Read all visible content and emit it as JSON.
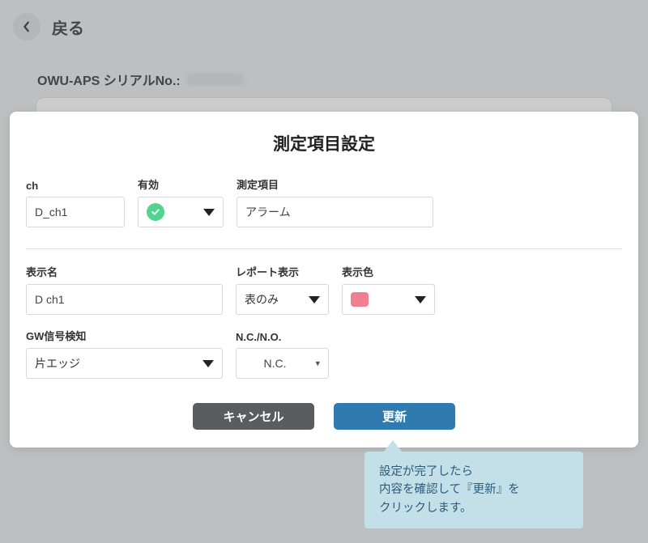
{
  "back_label": "戻る",
  "serial_prefix": "OWU-APS シリアルNo.:",
  "modal": {
    "title": "測定項目設定",
    "labels": {
      "ch": "ch",
      "enabled": "有効",
      "item": "測定項目",
      "display_name": "表示名",
      "report_display": "レポート表示",
      "display_color": "表示色",
      "gw_signal": "GW信号検知",
      "nc_no": "N.C./N.O."
    },
    "values": {
      "ch": "D_ch1",
      "item": "アラーム",
      "display_name": "D ch1",
      "report_display": "表のみ",
      "display_color": "#ef7f91",
      "gw_signal": "片エッジ",
      "nc_no": "N.C."
    },
    "buttons": {
      "cancel": "キャンセル",
      "submit": "更新"
    }
  },
  "callout": {
    "line1": "設定が完了したら",
    "line2": "内容を確認して『更新』を",
    "line3": "クリックします。"
  }
}
